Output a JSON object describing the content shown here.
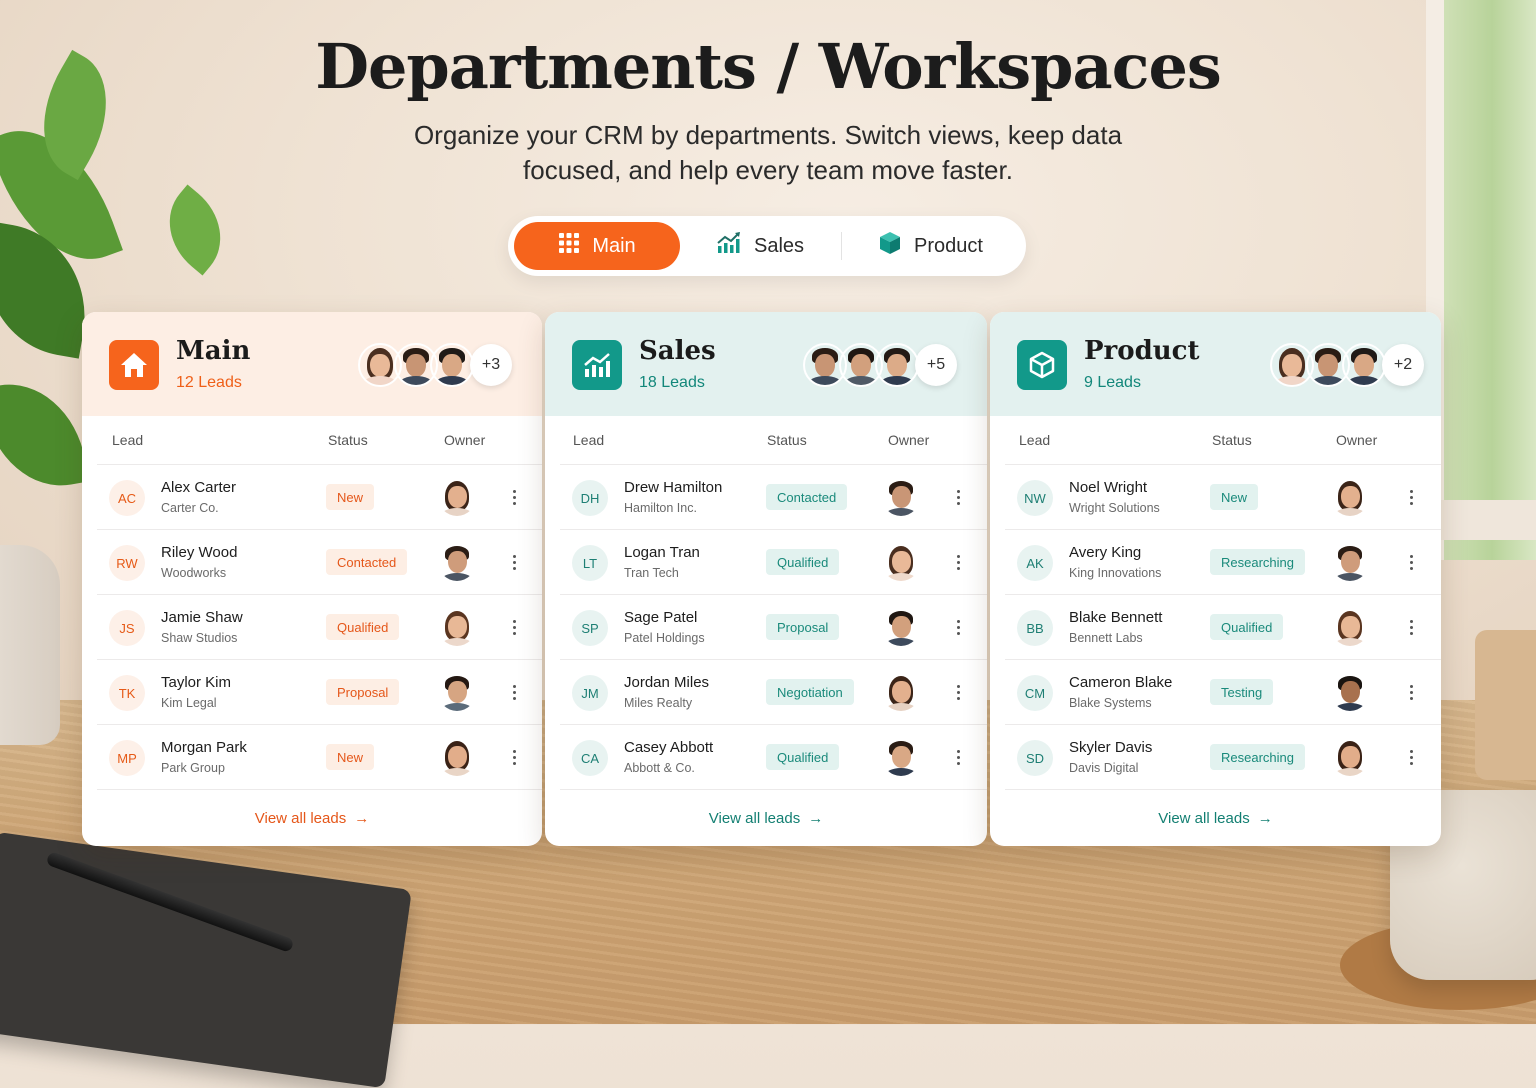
{
  "page": {
    "title": "Departments / Workspaces",
    "subtitle": "Organize your CRM by departments. Switch views, keep data focused, and help every team move faster."
  },
  "switcher": {
    "tabs": [
      {
        "label": "Main",
        "icon": "grid-icon",
        "active": true
      },
      {
        "label": "Sales",
        "icon": "chart-icon",
        "active": false
      },
      {
        "label": "Product",
        "icon": "box-icon",
        "active": false
      }
    ]
  },
  "colors": {
    "accent_orange": "#f6641c",
    "accent_teal": "#12998a"
  },
  "cards": [
    {
      "title": "Main",
      "count": "12 Leads",
      "icon": "home-icon",
      "more": "+3",
      "columns": {
        "lead": "Lead",
        "status": "Status",
        "owner": "Owner"
      },
      "rows": [
        {
          "initials": "AC",
          "name": "Alex Carter",
          "company": "Carter Co.",
          "status": "New"
        },
        {
          "initials": "RW",
          "name": "Riley Wood",
          "company": "Woodworks",
          "status": "Contacted"
        },
        {
          "initials": "JS",
          "name": "Jamie Shaw",
          "company": "Shaw Studios",
          "status": "Qualified"
        },
        {
          "initials": "TK",
          "name": "Taylor Kim",
          "company": "Kim Legal",
          "status": "Proposal"
        },
        {
          "initials": "MP",
          "name": "Morgan Park",
          "company": "Park Group",
          "status": "New"
        }
      ],
      "view_all": "View all leads"
    },
    {
      "title": "Sales",
      "count": "18 Leads",
      "icon": "chart-icon",
      "more": "+5",
      "columns": {
        "lead": "Lead",
        "status": "Status",
        "owner": "Owner"
      },
      "rows": [
        {
          "initials": "DH",
          "name": "Drew Hamilton",
          "company": "Hamilton Inc.",
          "status": "Contacted"
        },
        {
          "initials": "LT",
          "name": "Logan Tran",
          "company": "Tran Tech",
          "status": "Qualified"
        },
        {
          "initials": "SP",
          "name": "Sage Patel",
          "company": "Patel Holdings",
          "status": "Proposal"
        },
        {
          "initials": "JM",
          "name": "Jordan Miles",
          "company": "Miles Realty",
          "status": "Negotiation"
        },
        {
          "initials": "CA",
          "name": "Casey Abbott",
          "company": "Abbott & Co.",
          "status": "Qualified"
        }
      ],
      "view_all": "View all leads"
    },
    {
      "title": "Product",
      "count": "9 Leads",
      "icon": "box-icon",
      "more": "+2",
      "columns": {
        "lead": "Lead",
        "status": "Status",
        "owner": "Owner"
      },
      "rows": [
        {
          "initials": "NW",
          "name": "Noel Wright",
          "company": "Wright Solutions",
          "status": "New"
        },
        {
          "initials": "AK",
          "name": "Avery King",
          "company": "King Innovations",
          "status": "Researching"
        },
        {
          "initials": "BB",
          "name": "Blake Bennett",
          "company": "Bennett Labs",
          "status": "Qualified"
        },
        {
          "initials": "CM",
          "name": "Cameron Blake",
          "company": "Blake Systems",
          "status": "Testing"
        },
        {
          "initials": "SD",
          "name": "Skyler Davis",
          "company": "Davis Digital",
          "status": "Researching"
        }
      ],
      "view_all": "View all leads"
    }
  ]
}
